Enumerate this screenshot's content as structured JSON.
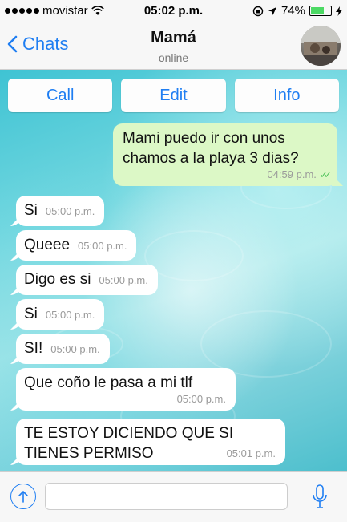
{
  "status_bar": {
    "carrier": "movistar",
    "time": "05:02 p.m.",
    "battery": "74%",
    "battery_level": 0.74
  },
  "header": {
    "back_label": "Chats",
    "contact_name": "Mamá",
    "contact_status": "online"
  },
  "actions": [
    {
      "label": "Call"
    },
    {
      "label": "Edit"
    },
    {
      "label": "Info"
    }
  ],
  "messages": [
    {
      "direction": "out",
      "text": "Mami puedo ir con unos chamos a la playa 3 dias?",
      "time": "04:59 p.m.",
      "status": "read"
    },
    {
      "direction": "in",
      "text": "Si",
      "time": "05:00 p.m."
    },
    {
      "direction": "in",
      "text": "Queee",
      "time": "05:00 p.m."
    },
    {
      "direction": "in",
      "text": "Digo es si",
      "time": "05:00 p.m."
    },
    {
      "direction": "in",
      "text": "Si",
      "time": "05:00 p.m."
    },
    {
      "direction": "in",
      "text": "SI!",
      "time": "05:00 p.m."
    },
    {
      "direction": "in",
      "text": "Que coño le pasa a mi tlf",
      "time": "05:00 p.m."
    },
    {
      "direction": "in",
      "text": "TE ESTOY DICIENDO QUE SI TIENES PERMISO",
      "time": "05:01 p.m."
    }
  ],
  "input": {
    "placeholder": ""
  },
  "colors": {
    "accent": "#1f7ef2",
    "outgoing_bubble": "#dcf8c6",
    "incoming_bubble": "#ffffff",
    "read_ticks": "#4fc15a"
  }
}
